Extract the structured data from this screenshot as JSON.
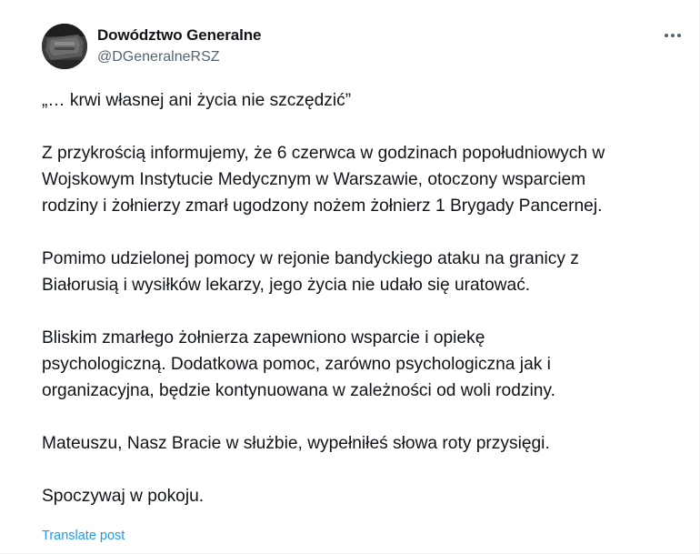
{
  "post": {
    "author": {
      "display_name": "Dowództwo Generalne",
      "handle": "@DGeneralneRSZ"
    },
    "icons": {
      "avatar": "avatar-image",
      "more": "more-horizontal-icon"
    },
    "paragraphs": [
      "„… krwi własnej ani życia nie szczędzić”",
      "Z przykrością informujemy, że 6 czerwca w godzinach popołudniowych w\nWojskowym Instytucie Medycznym w Warszawie, otoczony wsparciem\nrodziny i żołnierzy zmarł ugodzony nożem żołnierz 1 Brygady Pancernej.",
      "Pomimo udzielonej pomocy w rejonie bandyckiego ataku na granicy z\nBiałorusią i wysiłków lekarzy, jego życia nie udało się uratować.",
      "Bliskim zmarłego żołnierza zapewniono wsparcie i opiekę\npsychologiczną. Dodatkowa pomoc, zarówno psychologiczna jak i\norganizacyjna, będzie kontynuowana w zależności od woli rodziny.",
      "Mateuszu, Nasz Bracie w służbie, wypełniłeś słowa roty przysięgi.",
      "Spoczywaj w pokoju."
    ],
    "translate_label": "Translate post"
  },
  "colors": {
    "text_primary": "#0f1419",
    "text_secondary": "#536471",
    "link": "#1d9bf0"
  }
}
